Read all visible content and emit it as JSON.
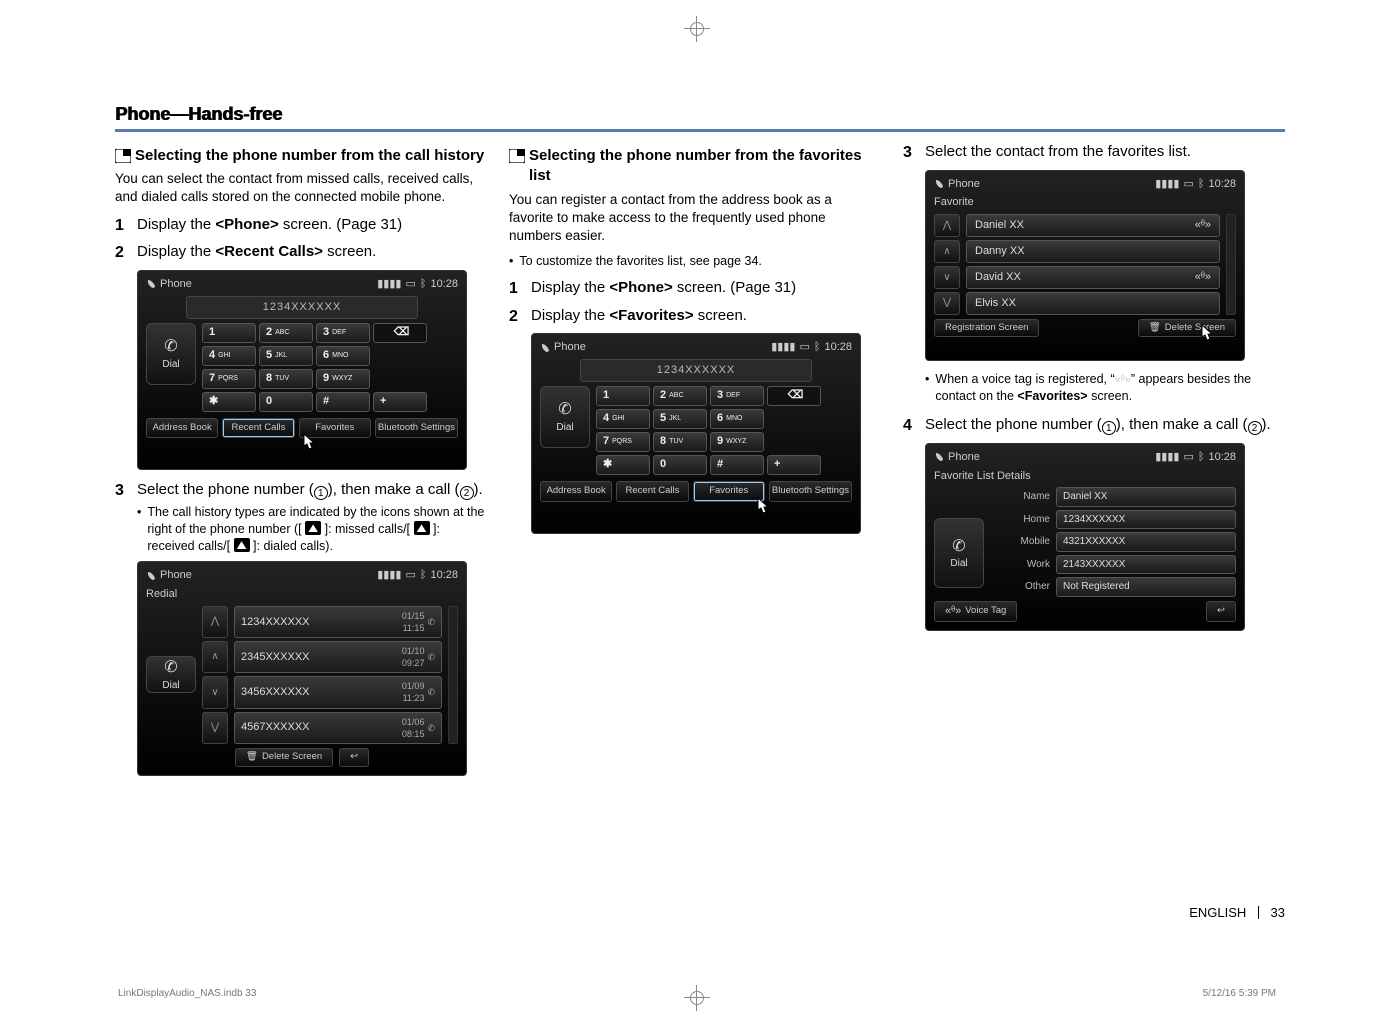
{
  "header": "Phone—Hands-free",
  "col1": {
    "subhead": "Selecting the phone number from the call history",
    "intro": "You can select the contact from missed calls, received calls, and dialed calls stored on the connected mobile phone.",
    "step1": {
      "num": "1",
      "body_pre": "Display the ",
      "tag": "<Phone>",
      "body_post": " screen. (Page 31)"
    },
    "step2": {
      "num": "2",
      "body_pre": "Display the ",
      "tag": "<Recent Calls>",
      "body_post": " screen."
    },
    "step3": {
      "num": "3",
      "line1_pre": "Select the phone number (",
      "line1_mid": "), then make a call (",
      "line1_post": ").",
      "bullet": "The call history types are indicated by the icons shown at the right of the phone number ([ ",
      "bullet_mid1": " ]: missed calls/[ ",
      "bullet_mid2": " ]: received calls/[ ",
      "bullet_end": " ]: dialed calls)."
    }
  },
  "col2": {
    "subhead": "Selecting the phone number from the favorites list",
    "intro": "You can register a contact from the address book as a favorite to make access to the frequently used phone numbers easier.",
    "bullet": "To customize the favorites list, see page 34.",
    "step1": {
      "num": "1",
      "body_pre": "Display the ",
      "tag": "<Phone>",
      "body_post": " screen. (Page 31)"
    },
    "step2": {
      "num": "2",
      "body_pre": "Display the ",
      "tag": "<Favorites>",
      "body_post": " screen."
    }
  },
  "col3": {
    "step3": {
      "num": "3",
      "body": "Select the contact from the favorites list."
    },
    "note_pre": "When a voice tag is registered, “",
    "note_post": "” appears besides the contact on the ",
    "note_tag": "<Favorites>",
    "note_end": " screen.",
    "step4": {
      "num": "4",
      "line_pre": "Select the phone number (",
      "line_mid": "), then make a call (",
      "line_post": ")."
    }
  },
  "ss_common": {
    "phone": "Phone",
    "time": "10:28",
    "readout": "1234XXXXXX",
    "dial": "Dial",
    "keys": [
      [
        "1",
        ""
      ],
      [
        "2",
        "ABC"
      ],
      [
        "3",
        "DEF"
      ],
      [
        "⌫",
        ""
      ],
      [
        "4",
        "GHI"
      ],
      [
        "5",
        "JKL"
      ],
      [
        "6",
        "MNO"
      ],
      [
        "",
        ""
      ],
      [
        "7",
        "PQRS"
      ],
      [
        "8",
        "TUV"
      ],
      [
        "9",
        "WXYZ"
      ],
      [
        "",
        ""
      ],
      [
        "✱",
        ""
      ],
      [
        "0",
        ""
      ],
      [
        "#",
        ""
      ],
      [
        "+",
        ""
      ]
    ],
    "tabs": [
      "Address Book",
      "Recent Calls",
      "Favorites",
      "Bluetooth Settings"
    ]
  },
  "ss_redial": {
    "title": "Redial",
    "rows": [
      {
        "num": "1234XXXXXX",
        "date": "01/15",
        "time": "11:15"
      },
      {
        "num": "2345XXXXXX",
        "date": "01/10",
        "time": "09:27"
      },
      {
        "num": "3456XXXXXX",
        "date": "01/09",
        "time": "11:23"
      },
      {
        "num": "4567XXXXXX",
        "date": "01/06",
        "time": "08:15"
      }
    ],
    "delete": "Delete Screen"
  },
  "ss_fav": {
    "title": "Favorite",
    "rows": [
      "Daniel XX",
      "Danny XX",
      "David XX",
      "Elvis XX"
    ],
    "voicetag_rows": [
      0,
      2
    ],
    "reg": "Registration Screen",
    "delete": "Delete Screen"
  },
  "ss_details": {
    "title": "Favorite List Details",
    "fields": [
      {
        "k": "Name",
        "v": "Daniel XX"
      },
      {
        "k": "Home",
        "v": "1234XXXXXX"
      },
      {
        "k": "Mobile",
        "v": "4321XXXXXX"
      },
      {
        "k": "Work",
        "v": "2143XXXXXX"
      },
      {
        "k": "Other",
        "v": "Not Registered"
      }
    ],
    "voice": "Voice Tag"
  },
  "footer": {
    "lang": "ENGLISH",
    "page": "33"
  },
  "print": {
    "left": "LinkDisplayAudio_NAS.indb   33",
    "right": "5/12/16   5:39 PM"
  }
}
